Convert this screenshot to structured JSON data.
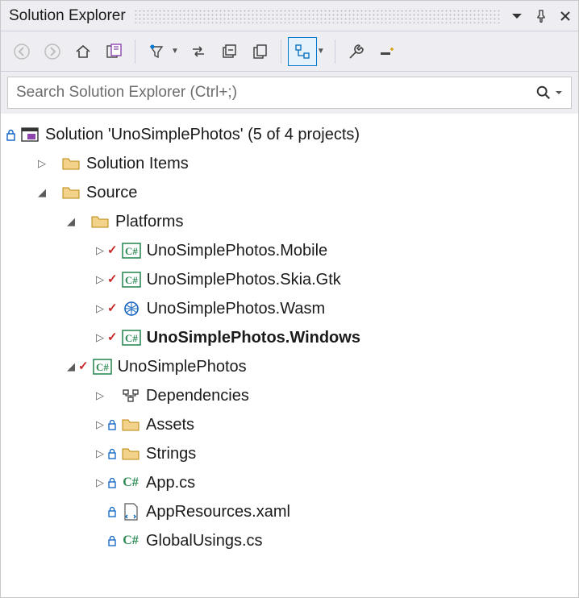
{
  "title": "Solution Explorer",
  "search": {
    "placeholder": "Search Solution Explorer (Ctrl+;)"
  },
  "solution": {
    "label": "Solution 'UnoSimplePhotos' (5 of 4 projects)"
  },
  "nodes": {
    "solutionItems": "Solution Items",
    "source": "Source",
    "platforms": "Platforms",
    "mobile": "UnoSimplePhotos.Mobile",
    "skia": "UnoSimplePhotos.Skia.Gtk",
    "wasm": "UnoSimplePhotos.Wasm",
    "windows": "UnoSimplePhotos.Windows",
    "mainProj": "UnoSimplePhotos",
    "dependencies": "Dependencies",
    "assets": "Assets",
    "strings": "Strings",
    "appcs": "App.cs",
    "appres": "AppResources.xaml",
    "globalusings": "GlobalUsings.cs"
  }
}
